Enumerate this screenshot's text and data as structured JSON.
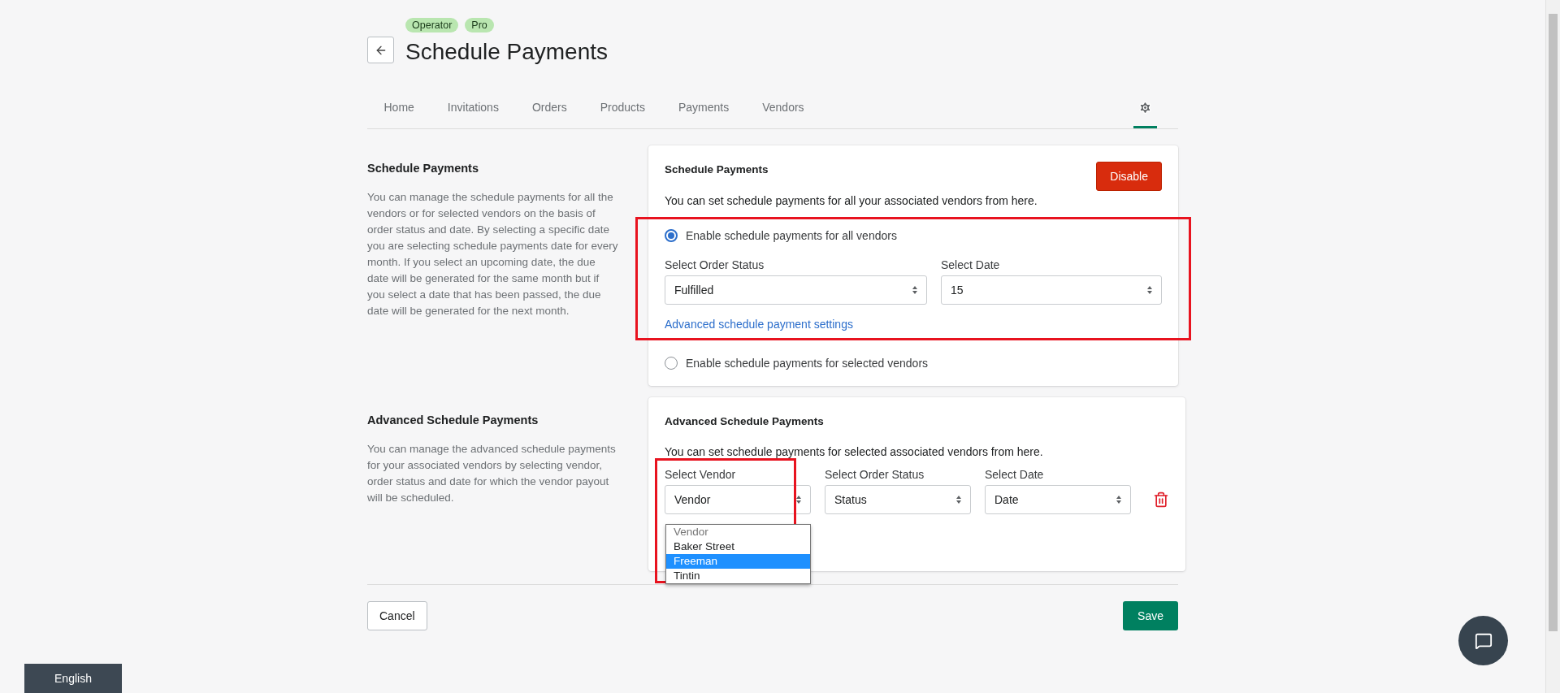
{
  "header": {
    "badges": [
      "Operator",
      "Pro"
    ],
    "title": "Schedule Payments"
  },
  "tabs": [
    {
      "label": "Home",
      "selected": false
    },
    {
      "label": "Invitations",
      "selected": false
    },
    {
      "label": "Orders",
      "selected": false
    },
    {
      "label": "Products",
      "selected": false
    },
    {
      "label": "Payments",
      "selected": false
    },
    {
      "label": "Vendors",
      "selected": false
    }
  ],
  "settings_tab": {
    "selected": true
  },
  "schedule_section": {
    "heading": "Schedule Payments",
    "description": "You can manage the schedule payments for all the vendors or for selected vendors on the basis of order status and date. By selecting a specific date you are selecting schedule payments date for every month. If you select an upcoming date, the due date will be generated for the same month but if you select a date that has been passed, the due date will be generated for the next month.",
    "card": {
      "title": "Schedule Payments",
      "button": "Disable",
      "subtitle": "You can set schedule payments for all your associated vendors from here.",
      "radio_all": {
        "label": "Enable schedule payments for all vendors",
        "selected": true
      },
      "fields": [
        {
          "label": "Select Order Status",
          "value": "Fulfilled"
        },
        {
          "label": "Select Date",
          "value": "15"
        }
      ],
      "link": "Advanced schedule payment settings",
      "radio_selected": {
        "label": "Enable schedule payments for selected vendors",
        "selected": false
      }
    }
  },
  "advanced_section": {
    "heading": "Advanced Schedule Payments",
    "description": "You can manage the advanced schedule payments for your associated vendors by selecting vendor, order status and date for which the vendor payout will be scheduled.",
    "card": {
      "title": "Advanced Schedule Payments",
      "subtitle": "You can set schedule payments for selected associated vendors from here.",
      "fields": [
        {
          "label": "Select Vendor",
          "value": "Vendor"
        },
        {
          "label": "Select Order Status",
          "value": "Status"
        },
        {
          "label": "Select Date",
          "value": "Date"
        }
      ],
      "vendor_options": [
        {
          "label": "Vendor",
          "kind": "placeholder",
          "selected": false
        },
        {
          "label": "Baker Street",
          "kind": "option",
          "selected": false
        },
        {
          "label": "Freeman",
          "kind": "option",
          "selected": true
        },
        {
          "label": "Tintin",
          "kind": "option",
          "selected": false
        }
      ]
    }
  },
  "footer": {
    "cancel": "Cancel",
    "save": "Save"
  },
  "language": "English"
}
